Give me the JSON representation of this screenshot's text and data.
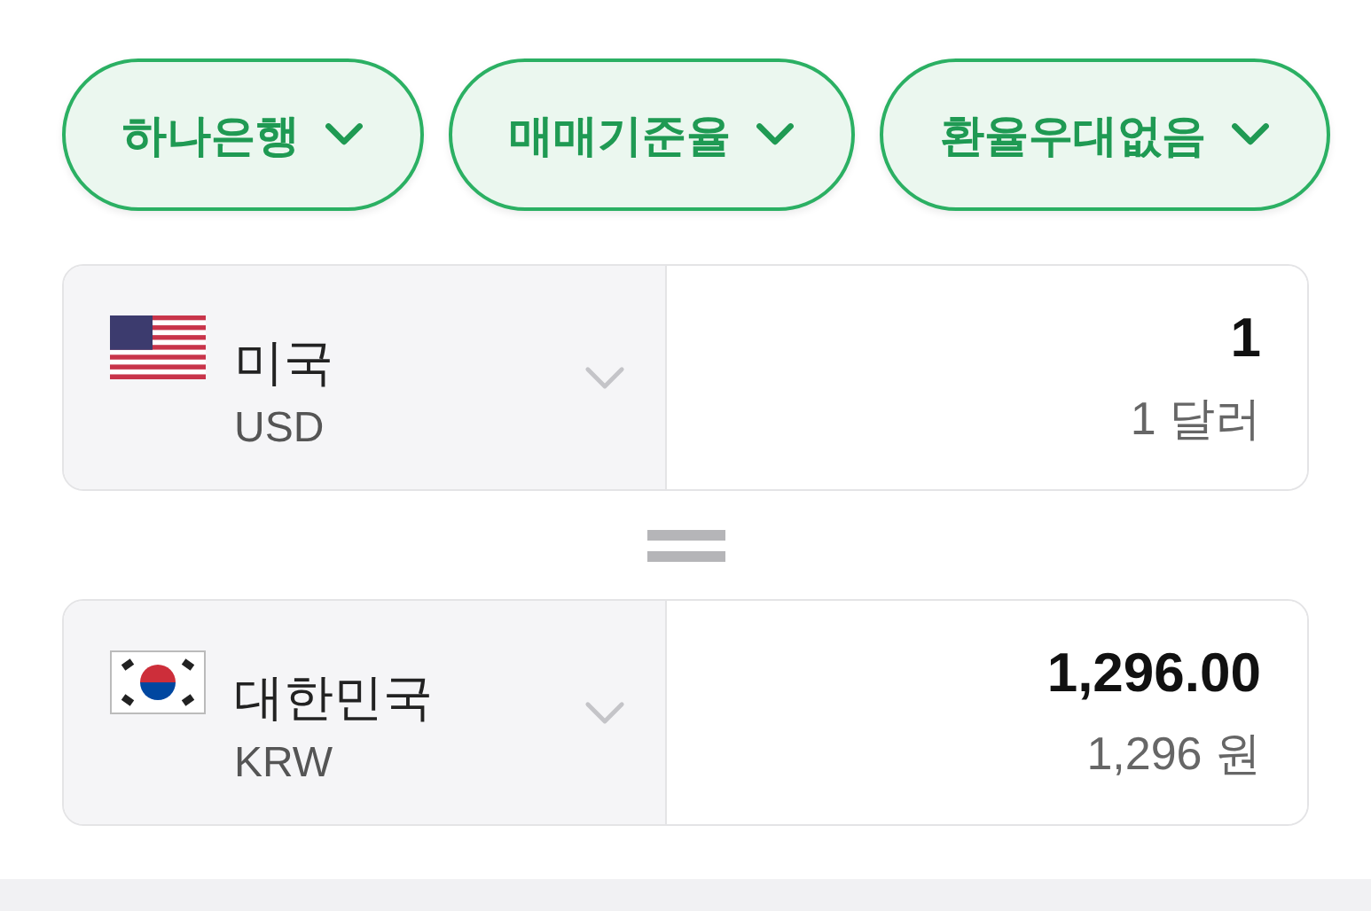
{
  "filters": [
    {
      "label": "하나은행"
    },
    {
      "label": "매매기준율"
    },
    {
      "label": "환율우대없음"
    }
  ],
  "converter": [
    {
      "kind": "us",
      "country": "미국",
      "code": "USD",
      "amount": "1",
      "amount_words": "1 달러"
    },
    {
      "kind": "kr",
      "country": "대한민국",
      "code": "KRW",
      "amount": "1,296.00",
      "amount_words": "1,296 원"
    }
  ]
}
